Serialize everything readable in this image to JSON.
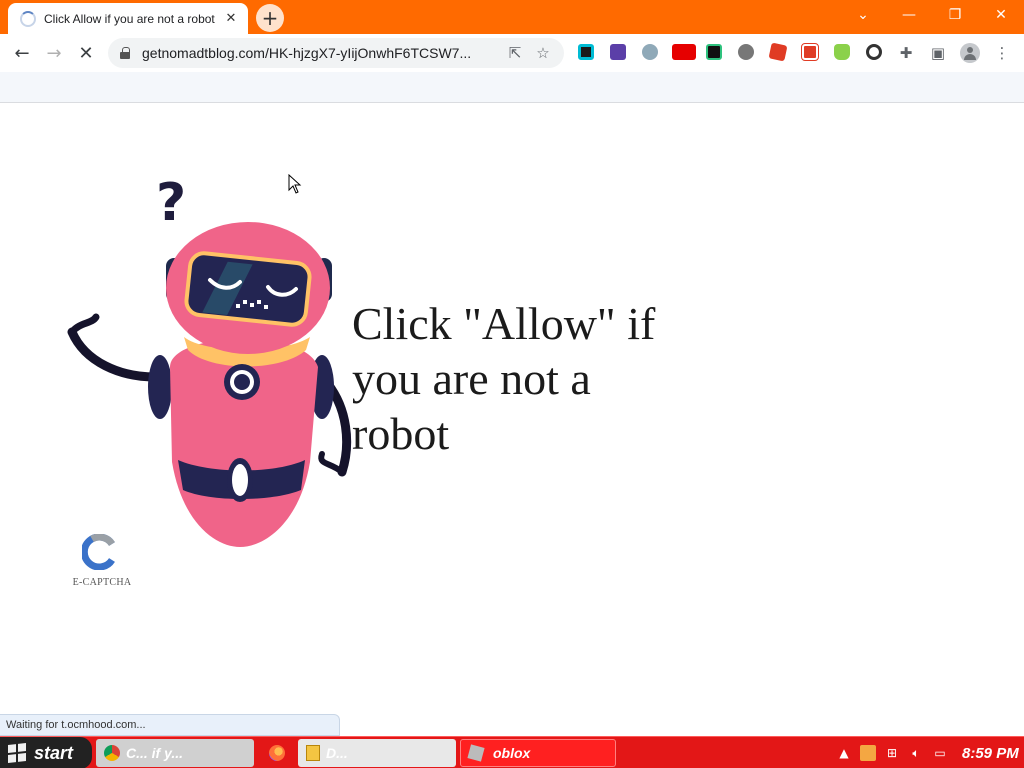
{
  "browser": {
    "tab": {
      "title": "Click Allow if you are not a robot"
    },
    "address_bar": {
      "url": "getnomadtblog.com/HK-hjzgX7-yIijOnwhF6TCSW7..."
    },
    "status_text": "Waiting for t.ocmhood.com..."
  },
  "page": {
    "headline": "Click \"Allow\" if you are not a robot",
    "captcha_label": "E-CAPTCHA"
  },
  "taskbar": {
    "start_label": "start",
    "items": [
      {
        "label": "C...    if y..."
      },
      {
        "label": "D..."
      },
      {
        "label": "oblox"
      }
    ],
    "clock": "8:59 PM"
  }
}
